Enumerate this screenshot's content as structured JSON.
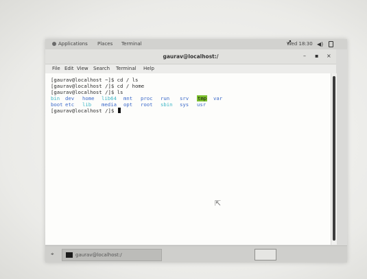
{
  "top_bar": {
    "applications_label": "Applications",
    "places_label": "Places",
    "terminal_label": "Terminal",
    "clock": "Wed 18:30",
    "volume_icon": "volume-icon",
    "power_icon": "power-icon"
  },
  "window": {
    "title": "gaurav@localhost:/",
    "minimize": "–",
    "maximize": "▪",
    "close": "×"
  },
  "menu": {
    "file": "File",
    "edit": "Edit",
    "view": "View",
    "search": "Search",
    "terminal": "Terminal",
    "help": "Help"
  },
  "terminal": {
    "lines": [
      "[gaurav@localhost ~]$ cd / ls",
      "[gaurav@localhost /]$ cd / home",
      "[gaurav@localhost /]$ ls"
    ],
    "ls_output": {
      "row1": [
        {
          "name": "bin",
          "kind": "link"
        },
        {
          "name": "dev",
          "kind": "dir"
        },
        {
          "name": "home",
          "kind": "dir"
        },
        {
          "name": "lib64",
          "kind": "link"
        },
        {
          "name": "mnt",
          "kind": "dir"
        },
        {
          "name": "proc",
          "kind": "dir"
        },
        {
          "name": "run",
          "kind": "dir"
        },
        {
          "name": "srv",
          "kind": "dir"
        },
        {
          "name": "tmp",
          "kind": "tmp"
        },
        {
          "name": "var",
          "kind": "dir"
        }
      ],
      "row2": [
        {
          "name": "boot",
          "kind": "dir"
        },
        {
          "name": "etc",
          "kind": "dir"
        },
        {
          "name": "lib",
          "kind": "link"
        },
        {
          "name": "media",
          "kind": "dir"
        },
        {
          "name": "opt",
          "kind": "dir"
        },
        {
          "name": "root",
          "kind": "dir"
        },
        {
          "name": "sbin",
          "kind": "link"
        },
        {
          "name": "sys",
          "kind": "dir"
        },
        {
          "name": "usr",
          "kind": "dir"
        }
      ]
    },
    "prompt": "[gaurav@localhost /]$ "
  },
  "taskbar": {
    "task_label": "gaurav@localhost:/",
    "show_desktop_icon": "show-desktop-icon"
  },
  "colors": {
    "dir": "#3a68c9",
    "link": "#3cb6c6",
    "tmp_bg": "#7bbf2c"
  }
}
